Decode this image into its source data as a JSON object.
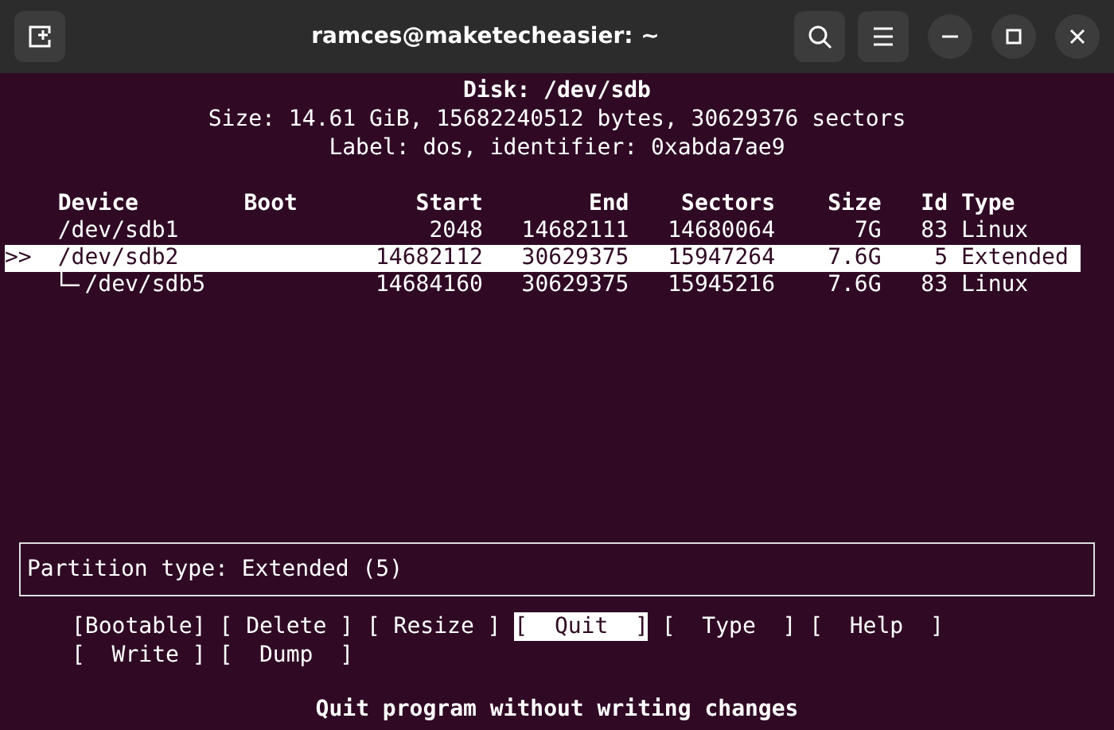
{
  "window": {
    "title": "ramces@maketecheasier: ~"
  },
  "disk": {
    "title": "Disk: /dev/sdb",
    "lines": [
      "Size: 14.61 GiB, 15682240512 bytes, 30629376 sectors",
      "Label: dos, identifier: 0xabda7ae9"
    ]
  },
  "table": {
    "cursor": ">>",
    "columns": [
      "Device",
      "Boot",
      "Start",
      "End",
      "Sectors",
      "Size",
      "Id",
      "Type"
    ],
    "rows": [
      {
        "device": "/dev/sdb1",
        "boot": "",
        "start": "2048",
        "end": "14682111",
        "sectors": "14680064",
        "size": "7G",
        "id": "83",
        "type": "Linux",
        "selected": false,
        "children": []
      },
      {
        "device": "/dev/sdb2",
        "start": "14682112",
        "end": "30629375",
        "sectors": "15947264",
        "size": "7.6G",
        "id": "5",
        "type": "Extended",
        "selected": true,
        "children": [
          {
            "device": "/dev/sdb5",
            "start": "14684160",
            "end": "30629375",
            "sectors": "15945216",
            "size": "7.6G",
            "id": "83",
            "type": "Linux",
            "selected": false
          }
        ]
      }
    ]
  },
  "info": "Partition type: Extended (5)",
  "buttons": [
    [
      {
        "label": "[Bootable]",
        "selected": false
      },
      {
        "label": "[ Delete ]",
        "selected": false
      },
      {
        "label": "[ Resize ]",
        "selected": false
      },
      {
        "label": "[  Quit  ]",
        "selected": true
      },
      {
        "label": "[  Type  ]",
        "selected": false
      },
      {
        "label": "[  Help  ]",
        "selected": false
      }
    ],
    [
      {
        "label": "[  Write ]",
        "selected": false
      },
      {
        "label": "[  Dump  ]",
        "selected": false
      }
    ]
  ],
  "status": "Quit program without writing changes"
}
